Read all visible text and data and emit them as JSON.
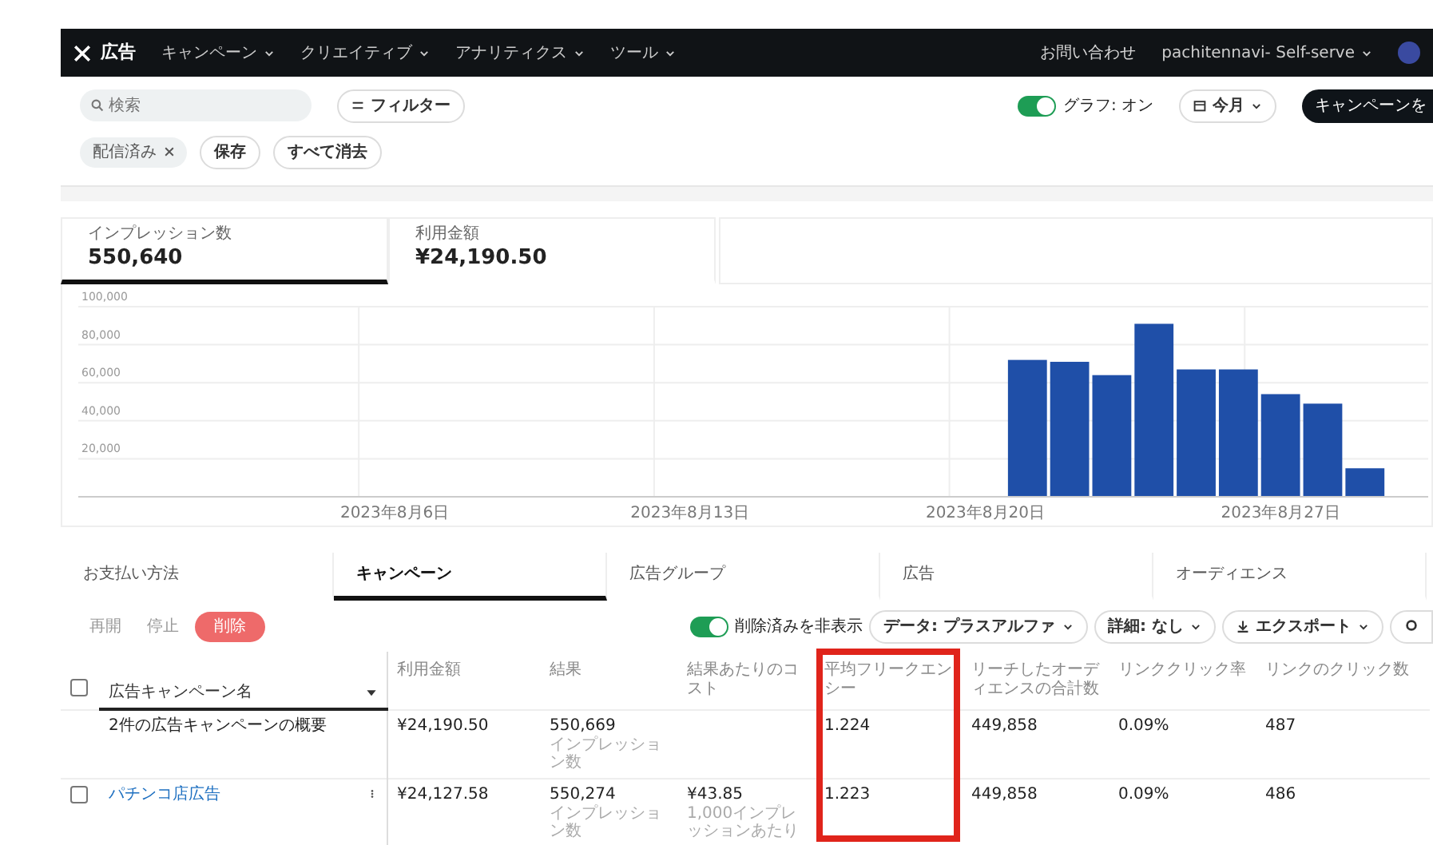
{
  "nav": {
    "brand": "広告",
    "menus": [
      {
        "label": "キャンペーン"
      },
      {
        "label": "クリエイティブ"
      },
      {
        "label": "アナリティクス"
      },
      {
        "label": "ツール"
      }
    ],
    "contact": "お問い合わせ",
    "account": "pachitennavi- Self-serve"
  },
  "toolbar": {
    "search": {
      "placeholder": "検索"
    },
    "filter_button": "フィルター",
    "graph_toggle": {
      "label": "グラフ: オン",
      "on": true
    },
    "date_button": "今月",
    "create_button": "キャンペーンを"
  },
  "filters": {
    "chips": [
      {
        "label": "配信済み"
      }
    ],
    "save": "保存",
    "clear": "すべて消去"
  },
  "metrics": [
    {
      "label": "インプレッション数",
      "value": "550,640",
      "selected": true
    },
    {
      "label": "利用金額",
      "value": "¥24,190.50",
      "selected": false
    }
  ],
  "chart_data": {
    "type": "bar",
    "grid": true,
    "categories": [
      null,
      null,
      null,
      null,
      null,
      null,
      null,
      "2023年8月6日",
      null,
      null,
      null,
      null,
      null,
      null,
      "2023年8月13日",
      null,
      null,
      null,
      null,
      null,
      null,
      "2023年8月20日",
      null,
      null,
      null,
      null,
      null,
      null,
      "2023年8月27日",
      null,
      null,
      null
    ],
    "ylim": [
      0,
      100000
    ],
    "yticks": [
      {
        "value": 20000,
        "label": "20,000"
      },
      {
        "value": 40000,
        "label": "40,000"
      },
      {
        "value": 60000,
        "label": "60,000"
      },
      {
        "value": 80000,
        "label": "80,000"
      },
      {
        "value": 100000,
        "label": "100,000"
      }
    ],
    "series": [
      {
        "color": "#1f4fa8",
        "values": [
          null,
          null,
          null,
          null,
          null,
          null,
          null,
          null,
          null,
          null,
          null,
          null,
          null,
          null,
          null,
          null,
          null,
          null,
          null,
          null,
          null,
          null,
          72000,
          71000,
          64000,
          91000,
          67000,
          67000,
          54000,
          49000,
          15000,
          null
        ]
      }
    ]
  },
  "tabs": [
    {
      "label": "お支払い方法",
      "selected": false
    },
    {
      "label": "キャンペーン",
      "selected": true
    },
    {
      "label": "広告グループ",
      "selected": false
    },
    {
      "label": "広告",
      "selected": false
    },
    {
      "label": "オーディエンス",
      "selected": false
    }
  ],
  "actions": {
    "buttons": [
      {
        "label": "再開",
        "kind": "plain"
      },
      {
        "label": "停止",
        "kind": "plain"
      },
      {
        "label": "削除",
        "kind": "danger"
      }
    ],
    "hide_deleted": {
      "label": "削除済みを非表示",
      "on": true
    },
    "dropdowns": [
      {
        "label": "データ: プラスアルファ",
        "kind": "menu"
      },
      {
        "label": "詳細: なし",
        "kind": "menu"
      },
      {
        "label": "エクスポート",
        "kind": "export"
      }
    ]
  },
  "table": {
    "select_all": {
      "checked": false
    },
    "columns": [
      {
        "label": "広告キャンペーン名",
        "highlighted": false
      },
      {
        "label": "利用金額",
        "highlighted": false
      },
      {
        "label": "結果",
        "highlighted": false
      },
      {
        "label": "結果あたりのコスト",
        "highlighted": false
      },
      {
        "label": "平均フリークエンシー",
        "highlighted": true
      },
      {
        "label": "リーチしたオーディエンスの合計数",
        "highlighted": false
      },
      {
        "label": "リンククリック率",
        "highlighted": false
      },
      {
        "label": "リンクのクリック数",
        "highlighted": false
      }
    ],
    "rows": [
      {
        "kind": "summary",
        "cells": [
          {
            "value": "2件の広告キャンペーンの概要"
          },
          {
            "value": "¥24,190.50"
          },
          {
            "value": "550,669",
            "sub": "インプレッション数"
          },
          null,
          {
            "value": "1.224"
          },
          {
            "value": "449,858"
          },
          {
            "value": "0.09%"
          },
          {
            "value": "487"
          }
        ]
      },
      {
        "kind": "campaign",
        "checked": false,
        "cells": [
          {
            "value": "パチンコ店広告"
          },
          {
            "value": "¥24,127.58"
          },
          {
            "value": "550,274",
            "sub": "インプレッション数"
          },
          {
            "value": "¥43.85",
            "sub": "1,000インプレッションあたり"
          },
          {
            "value": "1.223"
          },
          {
            "value": "449,858"
          },
          {
            "value": "0.09%"
          },
          {
            "value": "486"
          }
        ]
      }
    ]
  }
}
